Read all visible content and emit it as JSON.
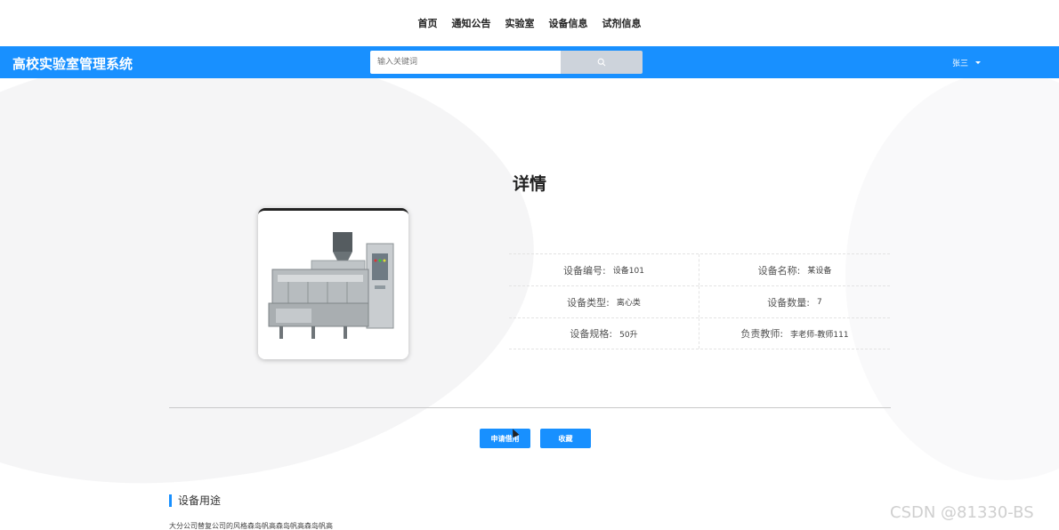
{
  "nav": {
    "items": [
      "首页",
      "通知公告",
      "实验室",
      "设备信息",
      "试剂信息"
    ]
  },
  "header": {
    "logo": "高校实验室管理系统",
    "user_name": "张三"
  },
  "search": {
    "placeholder": "输入关键词",
    "icon": "search-icon"
  },
  "page_title": "详情",
  "image": {
    "alt": "设备图片",
    "icon": "machine-image"
  },
  "details": [
    {
      "label": "设备编号:",
      "value": "设备101"
    },
    {
      "label": "设备名称:",
      "value": "某设备"
    },
    {
      "label": "设备类型:",
      "value": "离心类"
    },
    {
      "label": "设备数量:",
      "value": "7"
    },
    {
      "label": "设备规格:",
      "value": "50升"
    },
    {
      "label": "负责教师:",
      "value": "李老师-教师111"
    }
  ],
  "actions": {
    "apply": "申请借用",
    "favorite": "收藏"
  },
  "section": {
    "title": "设备用途",
    "text": "大分公司替复公司的风格森岛帆高森岛帆高森岛帆高"
  },
  "watermark": "CSDN @81330-BS",
  "colors": {
    "primary": "#1890ff",
    "search_button": "#cdd3db"
  }
}
